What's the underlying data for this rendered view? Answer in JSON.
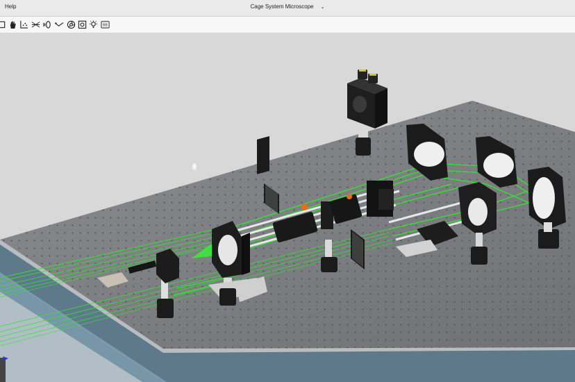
{
  "menu": {
    "help_label": "Help"
  },
  "document": {
    "title": "Cage System Microscope",
    "chevron_icon": "chevron-down-icon"
  },
  "toolbar": {
    "tools": [
      {
        "name": "select-box-icon"
      },
      {
        "name": "pan-hand-icon"
      },
      {
        "name": "axes-icon"
      },
      {
        "name": "rays-icon"
      },
      {
        "name": "lens-icon"
      },
      {
        "name": "beam-path-icon"
      },
      {
        "name": "aperture-icon"
      },
      {
        "name": "fit-view-icon"
      },
      {
        "name": "light-icon"
      },
      {
        "name": "bounding-box-icon"
      }
    ],
    "bounding_box_label": "BB"
  },
  "colors": {
    "beam": "#2ee82e",
    "table": "#7d7f82",
    "mount": "#1c1c1c",
    "post": "#dcdcdc"
  }
}
